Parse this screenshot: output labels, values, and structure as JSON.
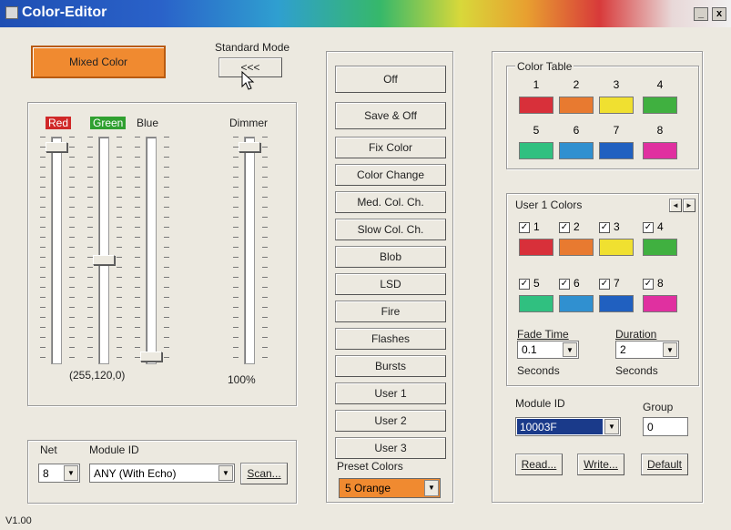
{
  "window": {
    "title": "Color-Editor",
    "minimize_symbol": "_",
    "close_symbol": "x"
  },
  "mode": {
    "current_button_label": "Mixed Color",
    "standard_mode_label": "Standard Mode",
    "back_button_label": "<<<"
  },
  "sliders": {
    "labels": {
      "red": "Red",
      "green": "Green",
      "blue": "Blue",
      "dimmer": "Dimmer"
    },
    "rgb_readout": "(255,120,0)",
    "dimmer_readout": "100%",
    "levels": {
      "red": 255,
      "green": 120,
      "blue": 0,
      "dimmer": 100
    }
  },
  "net_section": {
    "net_label": "Net",
    "net_value": "8",
    "module_id_label": "Module ID",
    "module_id_value": "ANY (With Echo)",
    "scan_button": "Scan..."
  },
  "program_buttons": [
    "Off",
    "Save & Off",
    "Fix Color",
    "Color Change",
    "Med. Col. Ch.",
    "Slow Col. Ch.",
    "Blob",
    "LSD",
    "Fire",
    "Flashes",
    "Bursts",
    "User 1",
    "User 2",
    "User 3"
  ],
  "preset": {
    "label": "Preset Colors",
    "value": "5  Orange"
  },
  "color_table": {
    "title": "Color Table",
    "colors": [
      {
        "num": "1",
        "hex": "#d8303a"
      },
      {
        "num": "2",
        "hex": "#e87a30"
      },
      {
        "num": "3",
        "hex": "#f0e030"
      },
      {
        "num": "4",
        "hex": "#40b040"
      },
      {
        "num": "5",
        "hex": "#30c080"
      },
      {
        "num": "6",
        "hex": "#3090d0"
      },
      {
        "num": "7",
        "hex": "#2060c0"
      },
      {
        "num": "8",
        "hex": "#e030a0"
      }
    ]
  },
  "user_colors": {
    "title": "User 1 Colors",
    "prev": "◄",
    "next": "►",
    "items": [
      {
        "num": "1",
        "checked": true,
        "hex": "#d8303a"
      },
      {
        "num": "2",
        "checked": true,
        "hex": "#e87a30"
      },
      {
        "num": "3",
        "checked": true,
        "hex": "#f0e030"
      },
      {
        "num": "4",
        "checked": true,
        "hex": "#40b040"
      },
      {
        "num": "5",
        "checked": true,
        "hex": "#30c080"
      },
      {
        "num": "6",
        "checked": true,
        "hex": "#3090d0"
      },
      {
        "num": "7",
        "checked": true,
        "hex": "#2060c0"
      },
      {
        "num": "8",
        "checked": true,
        "hex": "#e030a0"
      }
    ],
    "fade_label": "Fade Time",
    "fade_value": "0.1",
    "fade_unit": "Seconds",
    "duration_label": "Duration",
    "duration_value": "2",
    "duration_unit": "Seconds"
  },
  "module": {
    "id_label": "Module ID",
    "id_value": "10003F",
    "group_label": "Group",
    "group_value": "0",
    "read_button": "Read...",
    "write_button": "Write...",
    "default_button": "Default"
  },
  "footer": {
    "version": "V1.00"
  },
  "colors": {
    "accent_orange": "#f08a30",
    "selection_blue": "#1a3a8a"
  }
}
